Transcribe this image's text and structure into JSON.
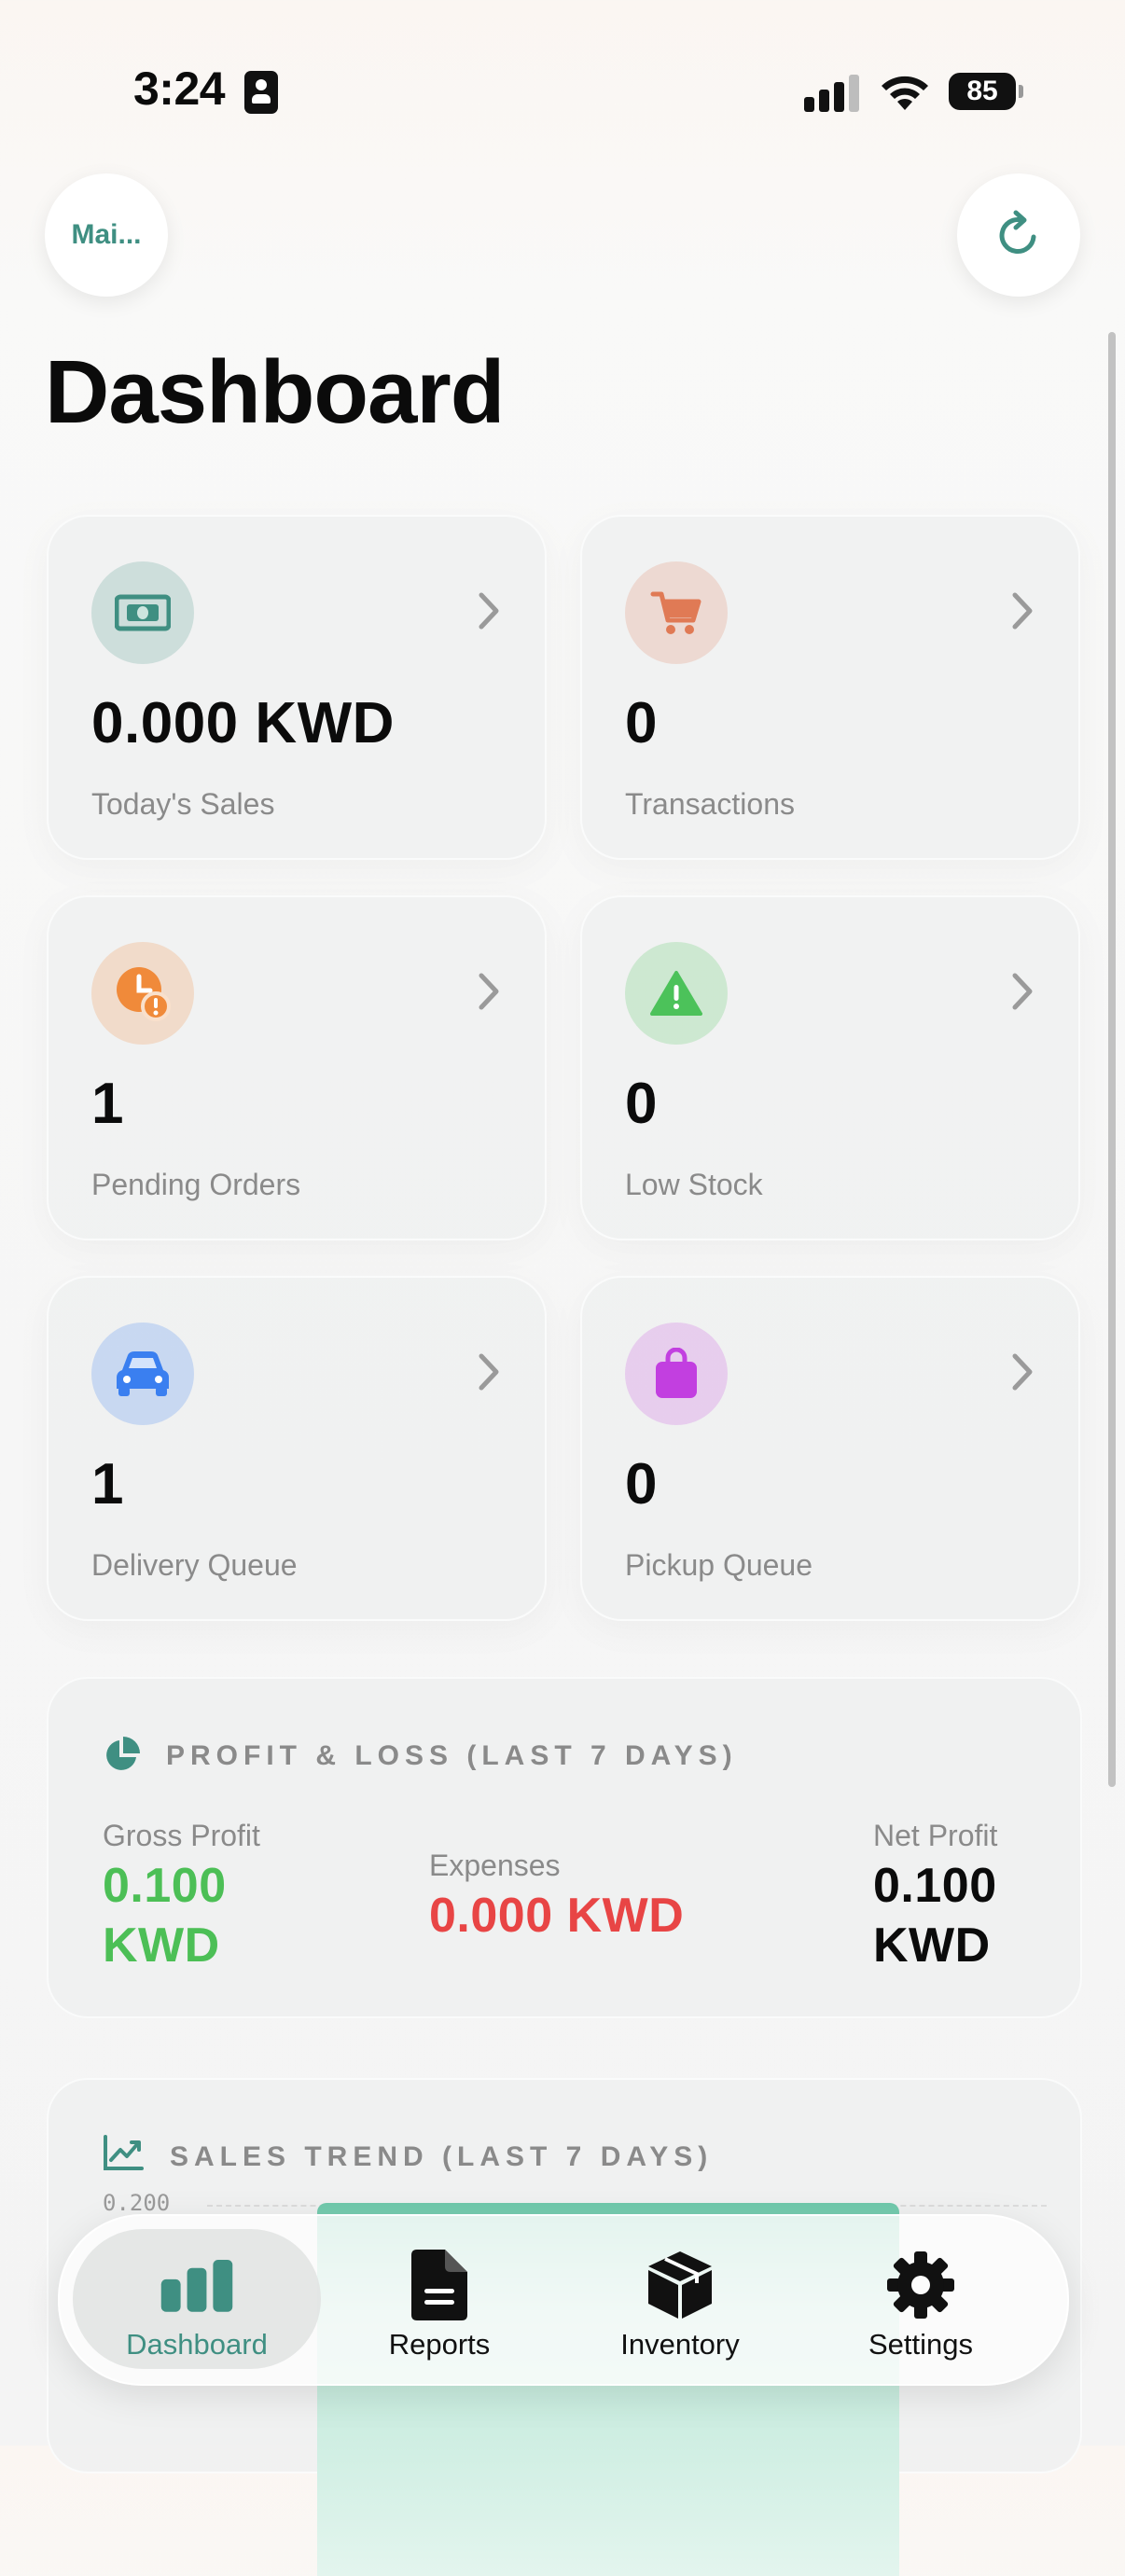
{
  "status_bar": {
    "time": "3:24",
    "battery": "85"
  },
  "header": {
    "store_label": "Mai...",
    "title": "Dashboard"
  },
  "cards": [
    {
      "value": "0.000 KWD",
      "label": "Today's Sales",
      "icon": "cash-icon",
      "color": "#3f8f82"
    },
    {
      "value": "0",
      "label": "Transactions",
      "icon": "cart-icon",
      "color": "#e07a55"
    },
    {
      "value": "1",
      "label": "Pending Orders",
      "icon": "clock-alert-icon",
      "color": "#f08a3a"
    },
    {
      "value": "0",
      "label": "Low Stock",
      "icon": "warning-icon",
      "color": "#4cc25a"
    },
    {
      "value": "1",
      "label": "Delivery Queue",
      "icon": "car-icon",
      "color": "#3a7ff0"
    },
    {
      "value": "0",
      "label": "Pickup Queue",
      "icon": "bag-icon",
      "color": "#c23fe0"
    }
  ],
  "profit_loss": {
    "title": "PROFIT & LOSS (LAST 7 DAYS)",
    "gross_label": "Gross Profit",
    "gross_value_1": "0.100",
    "gross_value_2": "KWD",
    "expenses_label": "Expenses",
    "expenses_value": "0.000 KWD",
    "net_label": "Net Profit",
    "net_value_1": "0.100",
    "net_value_2": "KWD",
    "colors": {
      "gross": "#4cbf56",
      "expenses": "#e84545",
      "net": "#0b0b0b"
    }
  },
  "sales_trend": {
    "title": "SALES TREND (LAST 7 DAYS)",
    "y_tick": "0.200"
  },
  "tabs": [
    {
      "label": "Dashboard",
      "icon": "bar-chart-icon",
      "active": true
    },
    {
      "label": "Reports",
      "icon": "document-icon",
      "active": false
    },
    {
      "label": "Inventory",
      "icon": "box-icon",
      "active": false
    },
    {
      "label": "Settings",
      "icon": "gear-icon",
      "active": false
    }
  ],
  "accent_color": "#3f8f82"
}
